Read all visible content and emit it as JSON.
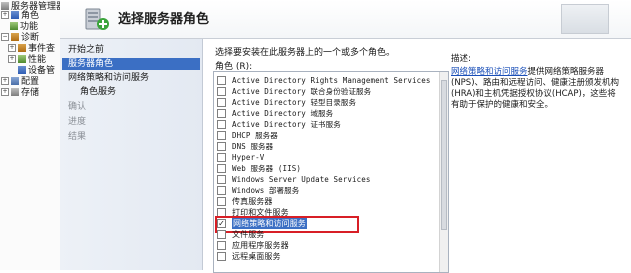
{
  "mmc_tree": {
    "items": [
      {
        "label": "服务器管理器",
        "expander": "",
        "icon": "server-icon"
      },
      {
        "label": "角色",
        "expander": "+",
        "icon": "roles-icon"
      },
      {
        "label": "功能",
        "expander": "",
        "icon": "features-icon"
      },
      {
        "label": "诊断",
        "expander": "−",
        "icon": "diagnostics-icon"
      },
      {
        "label": "事件查",
        "expander": "+",
        "icon": "event-viewer-icon"
      },
      {
        "label": "性能",
        "expander": "+",
        "icon": "performance-icon"
      },
      {
        "label": "设备管",
        "expander": "",
        "icon": "device-manager-icon"
      },
      {
        "label": "配置",
        "expander": "+",
        "icon": "configuration-icon"
      },
      {
        "label": "存储",
        "expander": "+",
        "icon": "storage-icon"
      }
    ]
  },
  "wizard": {
    "title": "选择服务器角色",
    "nav": [
      {
        "label": "开始之前",
        "state": "normal"
      },
      {
        "label": "服务器角色",
        "state": "selected"
      },
      {
        "label": "网络策略和访问服务",
        "state": "normal"
      },
      {
        "label": "角色服务",
        "state": "sub"
      },
      {
        "label": "确认",
        "state": "disabled"
      },
      {
        "label": "进度",
        "state": "disabled"
      },
      {
        "label": "结果",
        "state": "disabled"
      }
    ],
    "instruction": "选择要安装在此服务器上的一个或多个角色。",
    "roles_label": "角色 (R):",
    "roles": [
      {
        "label": "Active Directory Rights Management Services",
        "checked": false
      },
      {
        "label": "Active Directory 联合身份验证服务",
        "checked": false
      },
      {
        "label": "Active Directory 轻型目录服务",
        "checked": false
      },
      {
        "label": "Active Directory 域服务",
        "checked": false
      },
      {
        "label": "Active Directory 证书服务",
        "checked": false
      },
      {
        "label": "DHCP 服务器",
        "checked": false
      },
      {
        "label": "DNS 服务器",
        "checked": false
      },
      {
        "label": "Hyper-V",
        "checked": false
      },
      {
        "label": "Web 服务器 (IIS)",
        "checked": false
      },
      {
        "label": "Windows Server Update Services",
        "checked": false
      },
      {
        "label": "Windows 部署服务",
        "checked": false
      },
      {
        "label": "传真服务器",
        "checked": false
      },
      {
        "label": "打印和文件服务",
        "checked": false
      },
      {
        "label": "网络策略和访问服务",
        "checked": true
      },
      {
        "label": "文件服务",
        "checked": false
      },
      {
        "label": "应用程序服务器",
        "checked": false
      },
      {
        "label": "远程桌面服务",
        "checked": false
      }
    ],
    "description": {
      "title": "描述:",
      "link": "网络策略和访问服务",
      "text": "提供网络策略服务器(NPS)、路由和远程访问、健康注册颁发机构(HRA)和主机凭据授权协议(HCAP)，这些将有助于保护的健康和安全。"
    }
  },
  "colors": {
    "selection": "#3b6fc4",
    "highlight_box": "#d81f26",
    "link": "#1a4fb8"
  }
}
